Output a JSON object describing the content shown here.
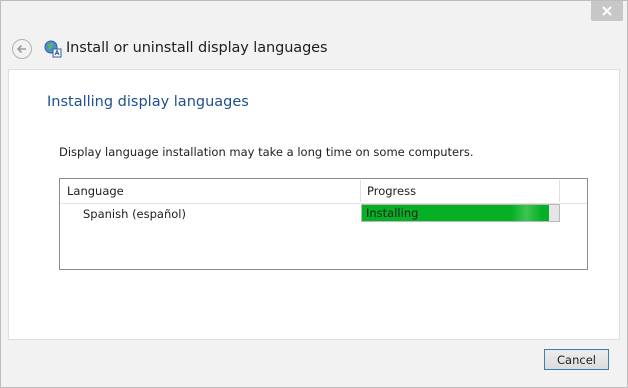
{
  "window": {
    "title": "Install or uninstall display languages",
    "close_icon": "close-icon",
    "back_icon": "back-arrow-icon",
    "title_icon": "globe-language-icon"
  },
  "content": {
    "heading": "Installing display languages",
    "description": "Display language installation may take a long time on some computers."
  },
  "table": {
    "columns": [
      "Language",
      "Progress"
    ],
    "rows": [
      {
        "language": "Spanish (español)",
        "progress_label": "Installing",
        "progress_fraction": 0.95
      }
    ]
  },
  "footer": {
    "cancel_label": "Cancel"
  },
  "colors": {
    "heading": "#1e4f91",
    "progress_fill": "#06b025",
    "close_button": "#c7c7c7"
  }
}
